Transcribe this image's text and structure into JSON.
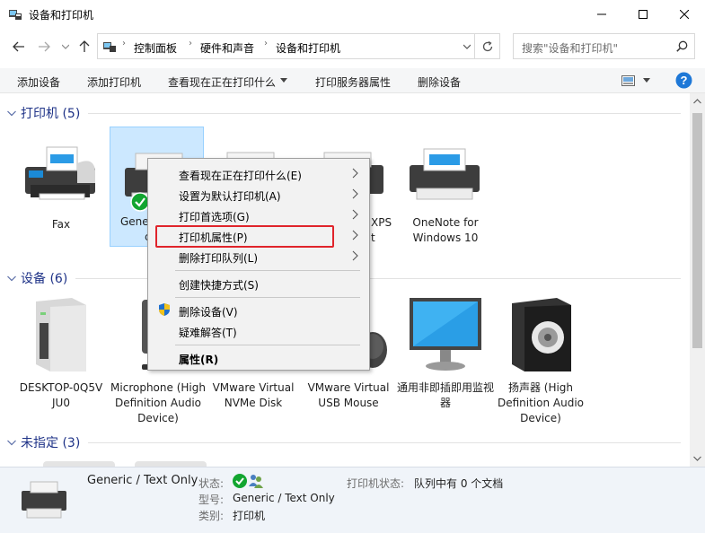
{
  "window": {
    "title": "设备和打印机"
  },
  "address": {
    "crumbs": [
      "控制面板",
      "硬件和声音",
      "设备和打印机"
    ]
  },
  "search": {
    "placeholder": "搜索\"设备和打印机\""
  },
  "commands": [
    "添加设备",
    "添加打印机",
    "查看现在正在打印什么",
    "打印服务器属性",
    "删除设备"
  ],
  "groups": {
    "printers": {
      "label": "打印机 (5)"
    },
    "devices": {
      "label": "设备 (6)"
    },
    "unspecified": {
      "label": "未指定 (3)"
    }
  },
  "printers": [
    {
      "label": "Fax"
    },
    {
      "label": "Gene"
    },
    {
      "label": "c"
    },
    {
      "label": "XPS"
    },
    {
      "label": "t"
    },
    {
      "label": "OneNote for Windows 10"
    }
  ],
  "devices": [
    {
      "label": "DESKTOP-0Q5V JU0"
    },
    {
      "label": "Microphone (High Definition Audio Device)"
    },
    {
      "label": "VMware Virtual NVMe Disk"
    },
    {
      "label": "VMware Virtual USB Mouse"
    },
    {
      "label": "通用非即插即用监视器"
    },
    {
      "label": "扬声器 (High Definition Audio Device)"
    }
  ],
  "context_menu": {
    "items": [
      {
        "label": "查看现在正在打印什么(E)"
      },
      {
        "label": "设置为默认打印机(A)"
      },
      {
        "label": "打印首选项(G)"
      },
      {
        "label": "打印机属性(P)"
      },
      {
        "label": "删除打印队列(L)"
      },
      {
        "label": "创建快捷方式(S)"
      },
      {
        "label": "删除设备(V)"
      },
      {
        "label": "疑难解答(T)"
      },
      {
        "label": "属性(R)"
      }
    ]
  },
  "details": {
    "name": "Generic / Text Only",
    "status_label": "状态:",
    "model_label": "型号:",
    "model_value": "Generic / Text Only",
    "category_label": "类别:",
    "category_value": "打印机",
    "printer_status_label": "打印机状态:",
    "printer_status_value": "队列中有 0 个文档"
  },
  "colors": {
    "accent": "#1e3287",
    "highlight_border": "#e0242b",
    "help": "#1e78d7",
    "selection": "#cce8ff"
  }
}
